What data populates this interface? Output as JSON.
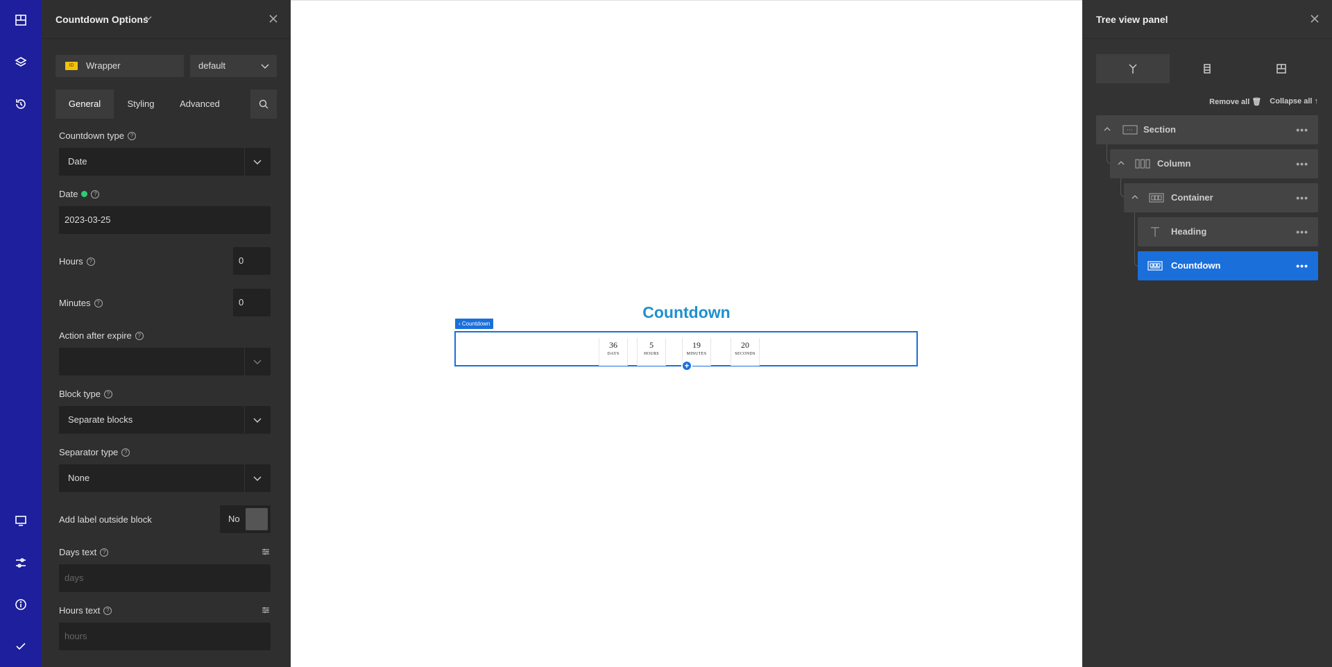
{
  "rail": {
    "items": [
      {
        "icon": "widgets-icon"
      },
      {
        "icon": "layers-icon"
      },
      {
        "icon": "history-icon"
      },
      {
        "icon": "desktop-icon"
      },
      {
        "icon": "settings-sliders-icon"
      },
      {
        "icon": "info-icon"
      },
      {
        "icon": "check-icon"
      }
    ]
  },
  "options": {
    "title": "Countdown Options",
    "wrapper": {
      "tag": "ID",
      "label": "Wrapper"
    },
    "preset": "default",
    "tabs": [
      "General",
      "Styling",
      "Advanced"
    ],
    "fields": {
      "countdown_type": {
        "label": "Countdown type",
        "value": "Date"
      },
      "date": {
        "label": "Date",
        "value": "2023-03-25"
      },
      "hours": {
        "label": "Hours",
        "value": "0"
      },
      "minutes": {
        "label": "Minutes",
        "value": "0"
      },
      "action_after_expire": {
        "label": "Action after expire",
        "value": ""
      },
      "block_type": {
        "label": "Block type",
        "value": "Separate blocks"
      },
      "separator_type": {
        "label": "Separator type",
        "value": "None"
      },
      "add_label_outside": {
        "label": "Add label outside block",
        "value": "No"
      },
      "days_text": {
        "label": "Days text",
        "placeholder": "days"
      },
      "hours_text": {
        "label": "Hours text",
        "placeholder": "hours"
      }
    }
  },
  "canvas": {
    "heading": "Countdown",
    "badge": "Countdown",
    "blocks": [
      {
        "num": "36",
        "unit": "DAYS"
      },
      {
        "num": "5",
        "unit": "HOURS"
      },
      {
        "num": "19",
        "unit": "MINUTES"
      },
      {
        "num": "20",
        "unit": "SECONDS"
      }
    ],
    "add": "+"
  },
  "tree": {
    "title": "Tree view panel",
    "remove_all": "Remove all",
    "collapse_all": "Collapse all",
    "nodes": [
      {
        "label": "Section",
        "icon": "section-icon"
      },
      {
        "label": "Column",
        "icon": "column-icon"
      },
      {
        "label": "Container",
        "icon": "container-icon"
      },
      {
        "label": "Heading",
        "icon": "heading-icon"
      },
      {
        "label": "Countdown",
        "icon": "countdown-icon",
        "selected": true
      }
    ],
    "dots": "•••"
  },
  "colors": {
    "rail": "#1d1f9c",
    "accent": "#1a6fdb",
    "heading": "#1e90d0",
    "panel": "#2f2f2f"
  }
}
